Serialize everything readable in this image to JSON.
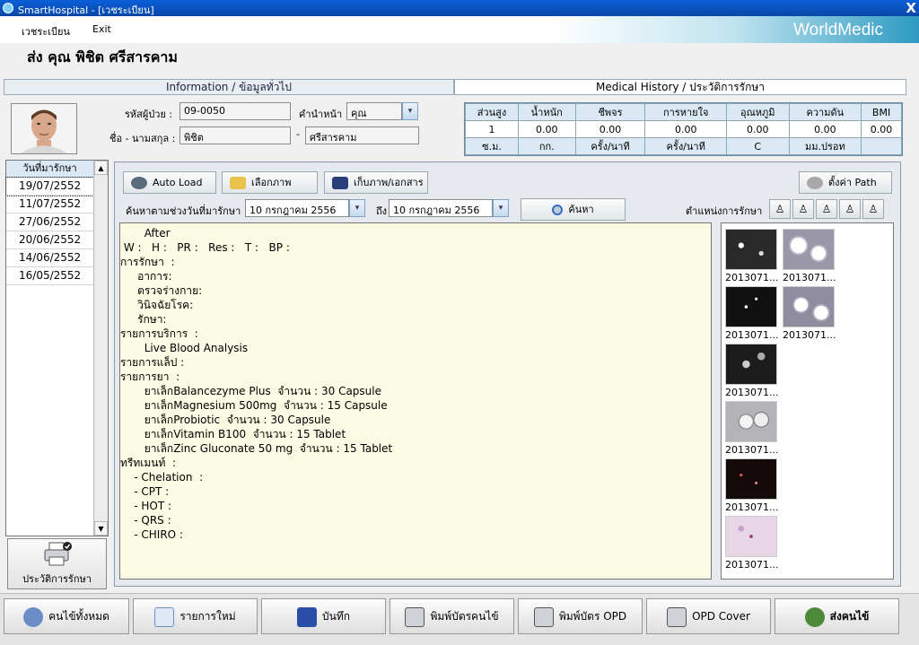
{
  "window": {
    "title": "SmartHospital - [เวชระเบียน]",
    "close": "X"
  },
  "menu": {
    "file": "เวชระเบียน",
    "exit": "Exit"
  },
  "brand": "WorldMedic",
  "patient": {
    "display_name": "ส่ง คุณ พิชิต ศรีสารคาม"
  },
  "tabs": {
    "info": "Information / ข้อมูลทั่วไป",
    "history": "Medical History / ประวัติการรักษา"
  },
  "form": {
    "hn_label": "รหัสผู้ป่วย :",
    "hn_value": "09-0050",
    "prefix_label": "คำนำหน้า :",
    "prefix_value": "คุณ",
    "name_label": "ชื่อ - นามสกุล :",
    "first_name": "พิชิต",
    "dash": "-",
    "last_name": "ศรีสารคาม"
  },
  "vitals": {
    "headers": [
      "ส่วนสูง",
      "น้ำหนัก",
      "ชีพจร",
      "การหายใจ",
      "อุณหภูมิ",
      "ความดัน",
      "BMI"
    ],
    "values": [
      "1",
      "0.00",
      "0.00",
      "0.00",
      "0.00",
      "0.00",
      "0.00"
    ],
    "units": [
      "ซ.ม.",
      "กก.",
      "ครั้ง/นาที",
      "ครั้ง/นาที",
      "C",
      "มม.ปรอท",
      ""
    ]
  },
  "dates": {
    "header": "วันที่มารักษา",
    "items": [
      "19/07/2552",
      "11/07/2552",
      "27/06/2552",
      "20/06/2552",
      "14/06/2552",
      "16/05/2552"
    ]
  },
  "history_button": "ประวัติการรักษา",
  "toolbar": {
    "auto_load": "Auto Load",
    "select_image": "เลือกภาพ",
    "scan": "เก็บภาพ/เอกสาร",
    "set_path": "ตั้งค่า Path",
    "search_range_label": "ค้นหาตามช่วงวันที่มารักษา",
    "from_date": "10 กรกฎาคม   2556",
    "to_label": "ถึง",
    "to_date": "10 กรกฎาคม   2556",
    "search": "ค้นหา",
    "position_label": "ตำแหน่งการรักษา"
  },
  "notes": [
    "       After",
    " W :   H :   PR :   Res :   T :   BP :",
    "การรักษา  :",
    "     อาการ:",
    "     ตรวจร่างกาย:",
    "     วินิจฉัยโรค:",
    "     รักษา:",
    "รายการบริการ  :",
    "       Live Blood Analysis",
    "รายการแล็ป :",
    "รายการยา  :",
    "       ยาเล็กBalancezyme Plus  จำนวน : 30 Capsule",
    "       ยาเล็กMagnesium 500mg  จำนวน : 15 Capsule",
    "       ยาเล็กProbiotic  จำนวน : 30 Capsule",
    "       ยาเล็กVitamin B100  จำนวน : 15 Tablet",
    "       ยาเล็กZinc Gluconate 50 mg  จำนวน : 15 Tablet",
    "ทรีทเมนท์  :",
    "    - Chelation  :",
    "    - CPT :",
    "    - HOT :",
    "    - QRS :",
    "    - CHIRO :"
  ],
  "thumbnails": [
    "2013071...",
    "2013071...",
    "2013071...",
    "2013071...",
    "2013071...",
    "2013071...",
    "2013071...",
    "2013071..."
  ],
  "bottom": {
    "all_patients": "คนไข้ทั้งหมด",
    "new_item": "รายการใหม่",
    "save": "บันทึก",
    "print_card": "พิมพ์บัตรคนไข้",
    "print_opd": "พิมพ์บัตร OPD",
    "opd_cover": "OPD Cover",
    "send_patient": "ส่งคนไข้"
  }
}
